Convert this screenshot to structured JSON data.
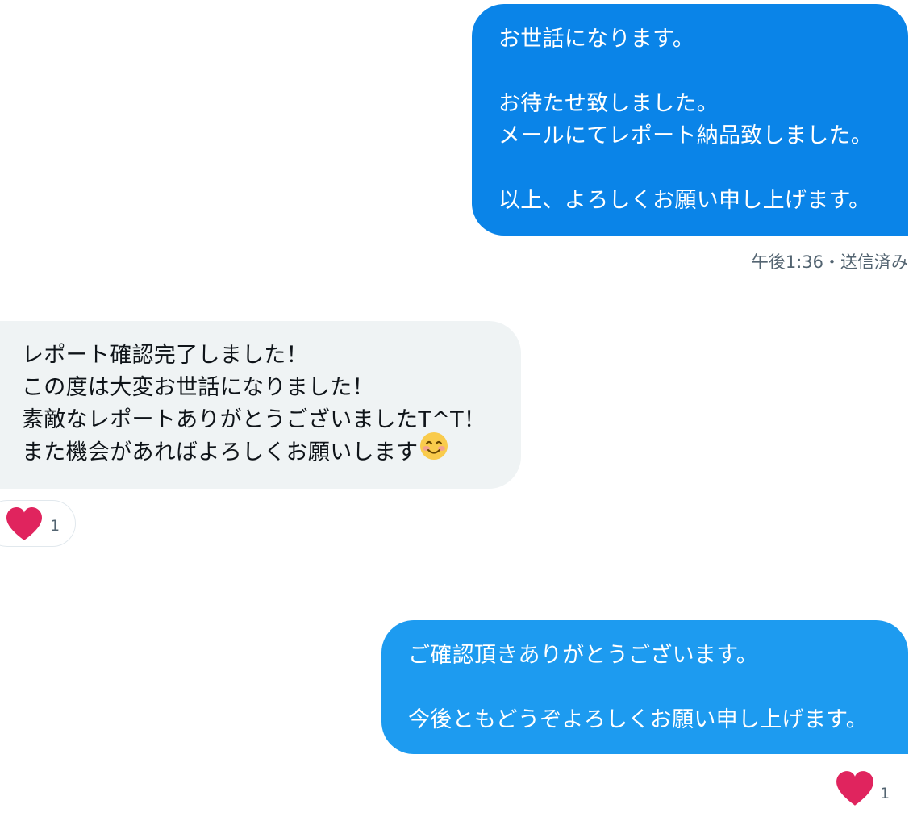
{
  "conversation": {
    "messages": [
      {
        "direction": "sent",
        "lines": [
          "お世話になります。",
          "",
          "お待たせ致しました。",
          "メールにてレポート納品致しました。",
          "",
          "以上、よろしくお願い申し上げます。"
        ],
        "timestamp": "午後1:36・送信済み",
        "bubble_color": "#0a84e8"
      },
      {
        "direction": "received",
        "lines": [
          "レポート確認完了しました！",
          "この度は大変お世話になりました！",
          "素敵なレポートありがとうございましたT^T！",
          "また機会があればよろしくお願いします"
        ],
        "trailing_icon": "smiling-face-emoji",
        "reaction": {
          "icon": "heart-icon",
          "count": "1"
        },
        "bubble_color": "#eff3f4"
      },
      {
        "direction": "sent",
        "lines": [
          "ご確認頂きありがとうございます。",
          "",
          "今後ともどうぞよろしくお願い申し上げます。"
        ],
        "reaction": {
          "icon": "heart-icon",
          "count": "1"
        },
        "bubble_color": "#1d9bf0"
      }
    ]
  },
  "colors": {
    "heart": "#e0245e",
    "text_primary": "#0f1419",
    "text_secondary": "#536471"
  }
}
